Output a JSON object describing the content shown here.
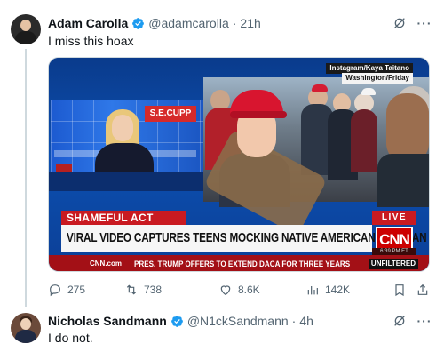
{
  "tweet1": {
    "display_name": "Adam Carolla",
    "handle": "@adamcarolla",
    "time": "21h",
    "text": "I miss this hoax",
    "media": {
      "credit_line1": "Instagram/Kaya Taitano",
      "credit_line2": "Washington/Friday",
      "cupp_label": "S.E.CUPP",
      "chyron_top": "SHAMEFUL ACT",
      "headline": "VIRAL VIDEO CAPTURES TEENS MOCKING NATIVE AMERICAN VETERAN",
      "live_label": "LIVE",
      "network_logo": "CNN",
      "clock": "6:39 PM ET",
      "ticker_logo": "CNN.com",
      "ticker_text": "PRES. TRUMP OFFERS TO EXTEND DACA FOR THREE YEARS",
      "unfiltered": "UNFILTERED"
    },
    "stats": {
      "replies": "275",
      "reposts": "738",
      "likes": "8.6K",
      "views": "142K"
    }
  },
  "tweet2": {
    "display_name": "Nicholas Sandmann",
    "handle": "@N1ckSandmann",
    "time": "4h",
    "text": "I do not."
  },
  "colors": {
    "verified": "#1d9bf0",
    "muted": "#536471",
    "text": "#0f1419",
    "cnn_red": "#cc0000"
  },
  "icons": [
    "verified-badge-icon",
    "grok-icon",
    "more-icon",
    "reply-icon",
    "repost-icon",
    "like-icon",
    "views-icon",
    "bookmark-icon",
    "share-icon"
  ]
}
